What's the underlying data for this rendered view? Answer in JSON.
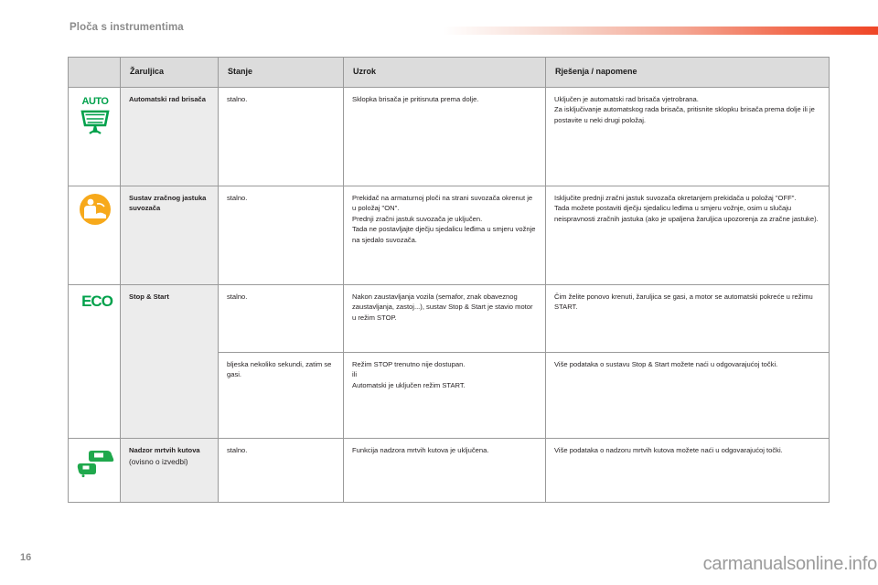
{
  "header": {
    "title": "Ploča s instrumentima",
    "accent_gradient_from": "#ffffff",
    "accent_gradient_to": "#ef4526"
  },
  "table": {
    "columns": [
      "",
      "Žaruljica",
      "Stanje",
      "Uzrok",
      "Rješenja / napomene"
    ],
    "rows": [
      {
        "icon": "auto-wiper-icon",
        "icon_label": "AUTO",
        "icon_color": "#00a14b",
        "name": "Automatski rad brisača",
        "variant": "",
        "state": "stalno.",
        "cause": "Sklopka brisača je pritisnuta prema dolje.",
        "solution": "Uključen je automatski rad brisača vjetrobrana.\nZa isključivanje automatskog rada brisača, pritisnite sklopku brisača prema dolje ili je postavite u neki drugi položaj."
      },
      {
        "icon": "passenger-airbag-icon",
        "icon_label": "",
        "icon_color": "#f7a91b",
        "name": "Sustav zračnog jastuka suvozača",
        "variant": "",
        "state": "stalno.",
        "cause": "Prekidač na armaturnoj ploči na strani suvozača okrenut je u položaj \"ON\".\nPrednji zračni jastuk suvozača je uključen.\nTada ne postavljajte dječju sjedalicu leđima u smjeru vožnje na sjedalo suvozača.",
        "solution": "Isključite prednji zračni jastuk suvozača okretanjem prekidača u položaj \"OFF\".\nTada možete postaviti dječju sjedalicu leđima u smjeru vožnje, osim u slučaju neispravnosti zračnih jastuka (ako je upaljena žaruljica upozorenja za zračne jastuke)."
      },
      {
        "icon": "eco-stop-start-icon",
        "icon_label": "ECO",
        "icon_color": "#00a14b",
        "name": "Stop & Start",
        "variant": "",
        "state": "stalno.",
        "cause": "Nakon zaustavljanja vozila (semafor, znak obaveznog zaustavljanja, zastoj...), sustav Stop & Start je stavio motor u režim STOP.",
        "solution": "Čim želite ponovo krenuti, žaruljica se gasi, a motor se automatski pokreće u režimu START."
      },
      {
        "icon": "",
        "icon_label": "",
        "icon_color": "",
        "name": "",
        "variant": "",
        "state": "bljeska nekoliko sekundi, zatim se gasi.",
        "cause": "Režim STOP trenutno nije dostupan.\nili\nAutomatski je uključen režim START.",
        "solution": "Više podataka o sustavu Stop & Start možete naći u odgovarajućoj točki."
      },
      {
        "icon": "blind-spot-monitor-icon",
        "icon_label": "",
        "icon_color": "#1fa84c",
        "name": "Nadzor mrtvih kutova",
        "variant": "(ovisno o izvedbi)",
        "state": "stalno.",
        "cause": "Funkcija nadzora mrtvih kutova je uključena.",
        "solution": "Više podataka o nadzoru mrtvih kutova možete naći u odgovarajućoj točki."
      }
    ]
  },
  "footer": {
    "page_number": "16",
    "watermark": "carmanualsonline.info"
  }
}
